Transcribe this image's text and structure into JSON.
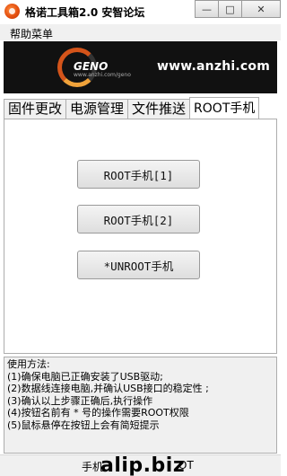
{
  "window": {
    "title": "格诺工具箱2.0 安智论坛",
    "icons": {
      "app": "geno-app-icon",
      "minimize": "minimize-icon",
      "maximize": "maximize-icon",
      "close": "close-icon"
    }
  },
  "menu": {
    "items": [
      "帮助菜单"
    ]
  },
  "banner": {
    "logo_text": "GENO",
    "logo_subtext": "www.anzhi.com/geno",
    "url": "www.anzhi.com"
  },
  "tabs": [
    {
      "label": "固件更改",
      "active": false
    },
    {
      "label": "电源管理",
      "active": false
    },
    {
      "label": "文件推送",
      "active": false
    },
    {
      "label": "ROOT手机",
      "active": true
    }
  ],
  "buttons": {
    "root1": "ROOT手机[1]",
    "root2": "ROOT手机[2]",
    "unroot": "*UNROOT手机"
  },
  "instructions": {
    "heading": "使用方法:",
    "lines": [
      "(1)确保电脑已正确安装了USB驱动;",
      "(2)数据线连接电脑,并确认USB接口的稳定性 ;",
      "(3)确认以上步骤正确后,执行操作",
      "(4)按钮名前有 * 号的操作需要ROOT权限",
      "(5)鼠标悬停在按钮上会有简短提示"
    ]
  },
  "statusbar": {
    "text": "手机",
    "text_end": "OT",
    "watermark": "alip.biz"
  },
  "colors": {
    "banner_bg": "#111111",
    "logo_orange": "#d4541a",
    "window_bg": "#f0f0f0"
  }
}
